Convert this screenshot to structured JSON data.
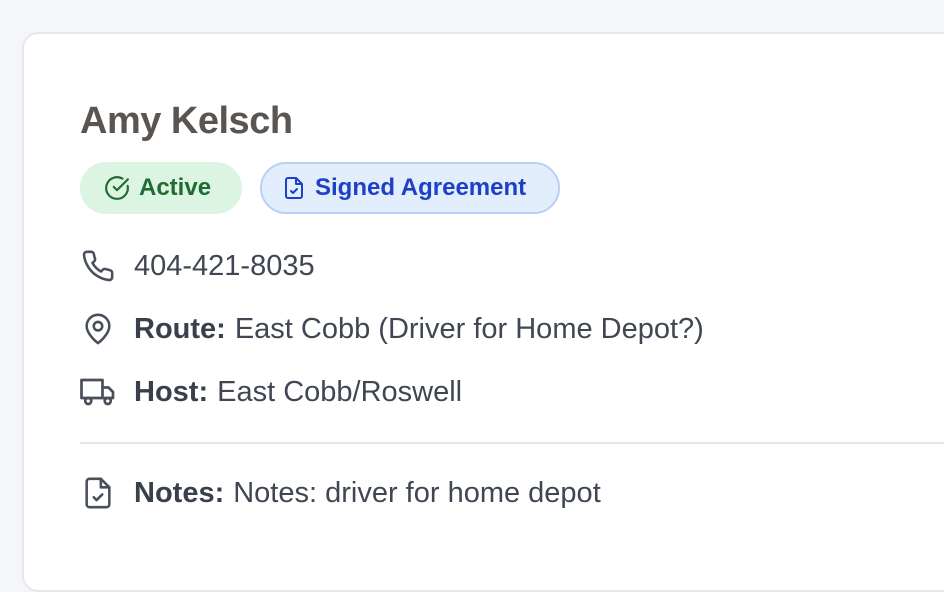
{
  "contact": {
    "name": "Amy Kelsch",
    "badges": {
      "active": "Active",
      "signed": "Signed Agreement"
    },
    "phone": "404-421-8035",
    "route": {
      "label": "Route:",
      "value": "East Cobb (Driver for Home Depot?)"
    },
    "host": {
      "label": "Host:",
      "value": "East Cobb/Roswell"
    },
    "notes": {
      "label": "Notes:",
      "value": "Notes: driver for home depot"
    }
  },
  "icons": {
    "active": "check-circle-icon",
    "signed": "file-check-icon",
    "phone": "phone-icon",
    "route": "map-pin-icon",
    "host": "truck-icon",
    "notes": "file-check-icon"
  },
  "colors": {
    "active_bg": "#dcf5e3",
    "active_text": "#1f6b34",
    "signed_bg": "#e3eefc",
    "signed_text": "#1e40c8",
    "name_text": "#5b5552",
    "body_text": "#404652"
  }
}
